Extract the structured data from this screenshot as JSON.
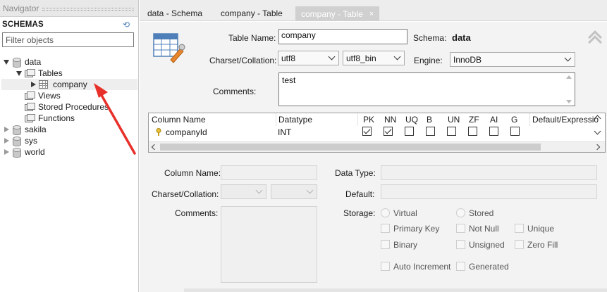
{
  "navigator": {
    "header": "Navigator",
    "schemas_title": "SCHEMAS",
    "filter_placeholder": "Filter objects",
    "tree": {
      "data": "data",
      "tables": "Tables",
      "company": "company",
      "views": "Views",
      "stored_procedures": "Stored Procedures",
      "functions": "Functions",
      "sakila": "sakila",
      "sys": "sys",
      "world": "world"
    }
  },
  "tabs": [
    {
      "label": "data - Schema"
    },
    {
      "label": "company - Table"
    },
    {
      "label": "company - Table",
      "active": true,
      "close": "×"
    }
  ],
  "editor": {
    "table_name_label": "Table Name:",
    "table_name_value": "company",
    "schema_label": "Schema:",
    "schema_value": "data",
    "charset_label": "Charset/Collation:",
    "charset_value": "utf8",
    "collation_value": "utf8_bin",
    "engine_label": "Engine:",
    "engine_value": "InnoDB",
    "comments_label": "Comments:",
    "comments_value": "test"
  },
  "columns_grid": {
    "headers": [
      "Column Name",
      "Datatype",
      "PK",
      "NN",
      "UQ",
      "B",
      "UN",
      "ZF",
      "AI",
      "G",
      "Default/Expressio"
    ],
    "rows": [
      {
        "name": "companyId",
        "datatype": "INT",
        "flags": {
          "PK": true,
          "NN": true,
          "UQ": false,
          "B": false,
          "UN": false,
          "ZF": false,
          "AI": false,
          "G": false
        }
      }
    ]
  },
  "column_details": {
    "column_name_label": "Column Name:",
    "charset_label": "Charset/Collation:",
    "comments_label": "Comments:",
    "data_type_label": "Data Type:",
    "default_label": "Default:",
    "storage_label": "Storage:",
    "virtual": "Virtual",
    "stored": "Stored",
    "primary_key": "Primary Key",
    "not_null": "Not Null",
    "unique": "Unique",
    "binary": "Binary",
    "unsigned": "Unsigned",
    "zero_fill": "Zero Fill",
    "auto_increment": "Auto Increment",
    "generated": "Generated"
  },
  "colors": {
    "annotation_arrow": "#e8302a",
    "tab_active_bg": "#d0d0d0",
    "editor_bg": "#f3f3f3"
  }
}
